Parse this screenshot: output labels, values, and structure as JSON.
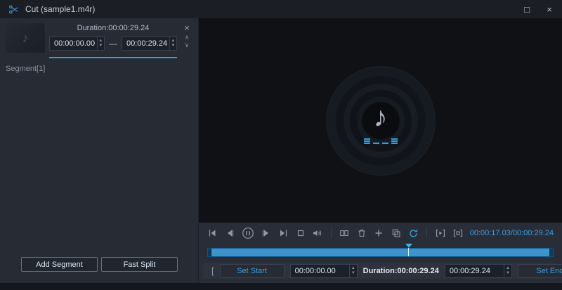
{
  "titlebar": {
    "title": "Cut (sample1.m4r)",
    "maximize_glyph": "□",
    "close_glyph": "×"
  },
  "glyphs": {
    "music_note": "♪",
    "spinner_up": "▲",
    "spinner_down": "▼",
    "close": "×",
    "move_up": "∧",
    "move_down": "∨",
    "range_dash": "—"
  },
  "segment_panel": {
    "duration_label": "Duration:00:00:29.24",
    "start_time": "00:00:00.00",
    "end_time": "00:00:29.24",
    "segment_label": "Segment[1]",
    "add_segment_button": "Add Segment",
    "fast_split_button": "Fast Split"
  },
  "player": {
    "current_time": "00:00:17.03",
    "time_separator": "/",
    "total_time": "00:00:29.24",
    "progress_percent": 58.2,
    "icons": [
      "skip-start",
      "frame-back",
      "pause",
      "frame-forward",
      "skip-end",
      "stop",
      "volume",
      "split",
      "delete",
      "add",
      "copy",
      "reset",
      "play-segment",
      "stop-segment"
    ]
  },
  "trim_bar": {
    "left_bracket": "[",
    "set_start_button": "Set Start",
    "start_time": "00:00:00.00",
    "duration_label": "Duration:00:00:29.24",
    "end_time": "00:00:29.24",
    "set_end_button": "Set End",
    "right_bracket": "]"
  },
  "colors": {
    "accent": "#2f9ee0",
    "icon": "#9099a8",
    "background": "#262b34",
    "preview_background": "#0f1115"
  }
}
